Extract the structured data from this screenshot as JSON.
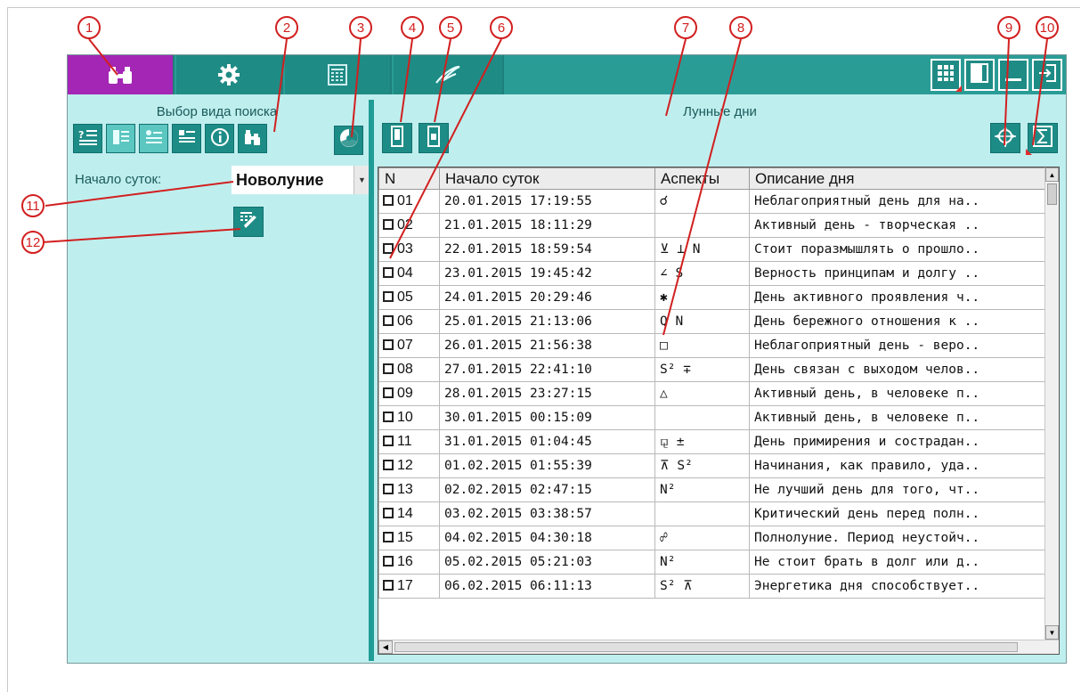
{
  "left_panel": {
    "title": "Выбор вида поиска",
    "start_label": "Начало суток:",
    "start_value": "Новолуние"
  },
  "right_panel": {
    "title": "Лунные дни"
  },
  "table": {
    "headers": [
      "N",
      "Начало суток",
      "Аспекты",
      "Описание дня"
    ],
    "rows": [
      {
        "n": "01",
        "start": "20.01.2015 17:19:55",
        "aspects": "☌",
        "desc": "Неблагоприятный день для на.."
      },
      {
        "n": "02",
        "start": "21.01.2015 18:11:29",
        "aspects": "",
        "desc": "Активный день - творческая .."
      },
      {
        "n": "03",
        "start": "22.01.2015 18:59:54",
        "aspects": "⊻ ⊥ N",
        "desc": "Стоит поразмышлять о прошло.."
      },
      {
        "n": "04",
        "start": "23.01.2015 19:45:42",
        "aspects": "∠ S",
        "desc": "Верность принципам и долгу .."
      },
      {
        "n": "05",
        "start": "24.01.2015 20:29:46",
        "aspects": "✱",
        "desc": "День активного проявления ч.."
      },
      {
        "n": "06",
        "start": "25.01.2015 21:13:06",
        "aspects": "Q Ν",
        "desc": "День бережного отношения к .."
      },
      {
        "n": "07",
        "start": "26.01.2015 21:56:38",
        "aspects": "□",
        "desc": "Неблагоприятный день - веро.."
      },
      {
        "n": "08",
        "start": "27.01.2015 22:41:10",
        "aspects": "S² ∓",
        "desc": "День связан с выходом челов.."
      },
      {
        "n": "09",
        "start": "28.01.2015 23:27:15",
        "aspects": "△",
        "desc": "Активный день, в человеке п.."
      },
      {
        "n": "10",
        "start": "30.01.2015 00:15:09",
        "aspects": "",
        "desc": "Активный день, в человеке п.."
      },
      {
        "n": "11",
        "start": "31.01.2015 01:04:45",
        "aspects": "⚼ ±",
        "desc": "День примирения и сострадан.."
      },
      {
        "n": "12",
        "start": "01.02.2015 01:55:39",
        "aspects": "⊼ S²",
        "desc": "Начинания, как правило, уда.."
      },
      {
        "n": "13",
        "start": "02.02.2015 02:47:15",
        "aspects": "N²",
        "desc": "Не лучший день для того, чт.."
      },
      {
        "n": "14",
        "start": "03.02.2015 03:38:57",
        "aspects": "",
        "desc": "Критический день перед полн.."
      },
      {
        "n": "15",
        "start": "04.02.2015 04:30:18",
        "aspects": "☍",
        "desc": "Полнолуние. Период неустойч.."
      },
      {
        "n": "16",
        "start": "05.02.2015 05:21:03",
        "aspects": "N²",
        "desc": "Не стоит брать в долг или д.."
      },
      {
        "n": "17",
        "start": "06.02.2015 06:11:13",
        "aspects": "S² ⊼",
        "desc": "Энергетика дня способствует.."
      }
    ]
  },
  "callouts": [
    "1",
    "2",
    "3",
    "4",
    "5",
    "6",
    "7",
    "8",
    "9",
    "10",
    "11",
    "12"
  ],
  "colors": {
    "accent_purple": "#a426b4",
    "teal": "#2a9c96",
    "panel_bg": "#bfeeee",
    "callout_red": "#d21f1f"
  },
  "icons": [
    "binoculars-icon",
    "gear-icon",
    "calendar-icon",
    "signature-icon",
    "grid-view-icon",
    "panel-view-icon",
    "minimize-icon",
    "exit-icon"
  ]
}
